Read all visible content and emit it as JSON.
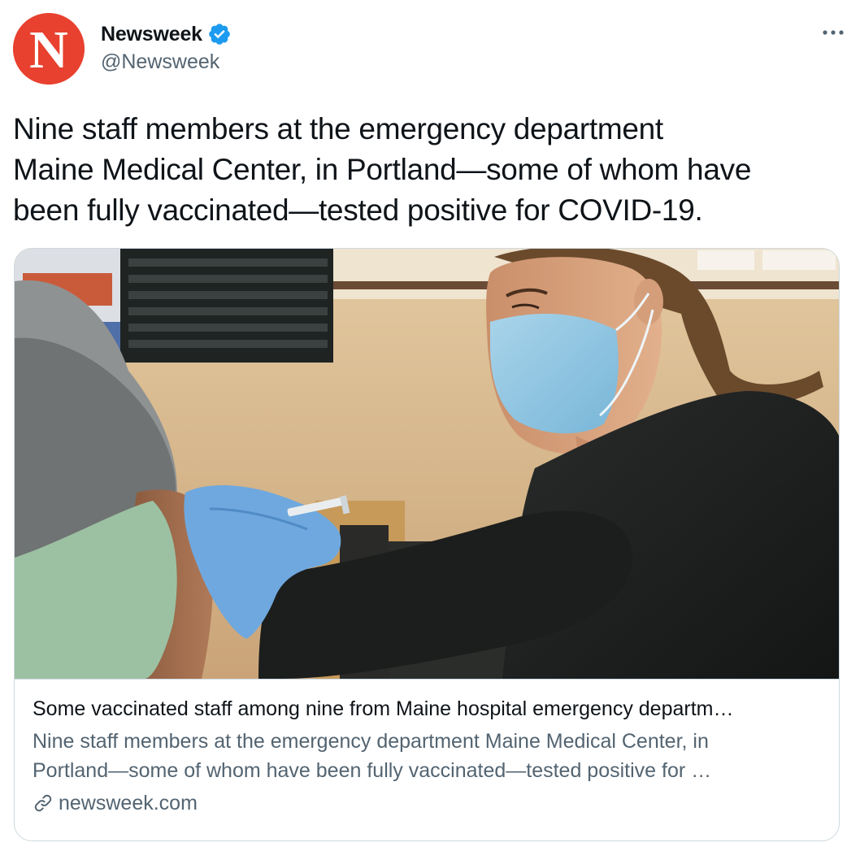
{
  "author": {
    "display_name": "Newsweek",
    "handle": "@Newsweek",
    "avatar_letter": "N",
    "verified": true,
    "avatar_color": "#e8412f"
  },
  "tweet": {
    "text_lines": [
      "Nine staff members at the emergency department",
      "Maine Medical Center, in Portland—some of whom have",
      "been fully vaccinated—tested positive for COVID-19."
    ]
  },
  "card": {
    "title": "Some vaccinated staff among nine from Maine hospital emergency departm…",
    "description_lines": [
      "Nine staff members at the emergency department Maine Medical Center, in",
      "Portland—some of whom have been fully vaccinated—tested positive for …"
    ],
    "domain": "newsweek.com"
  },
  "icons": {
    "more": "more-horizontal-icon",
    "verified": "verified-badge-icon",
    "link": "link-icon"
  },
  "colors": {
    "verified_blue": "#1d9bf0",
    "secondary_text": "#536471",
    "border": "#cfd9de"
  }
}
